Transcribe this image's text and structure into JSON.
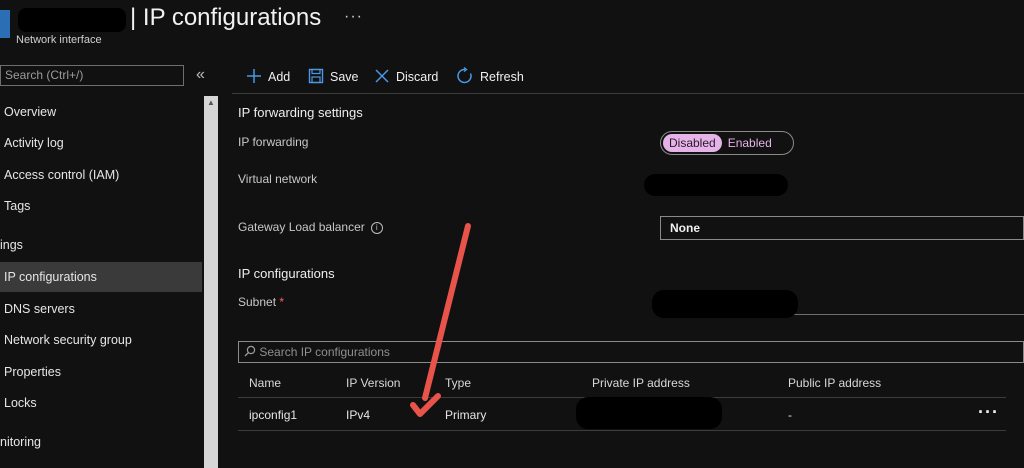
{
  "header": {
    "title": "| IP configurations",
    "more": "···",
    "subtitle": "Network interface"
  },
  "sidebar": {
    "search_placeholder": "Search (Ctrl+/)",
    "collapse": "«",
    "items": [
      {
        "label": "Overview"
      },
      {
        "label": "Activity log"
      },
      {
        "label": "Access control (IAM)"
      },
      {
        "label": "Tags"
      }
    ],
    "section_settings": "ings",
    "settings_items": [
      {
        "label": "IP configurations",
        "active": true
      },
      {
        "label": "DNS servers"
      },
      {
        "label": "Network security group"
      },
      {
        "label": "Properties"
      },
      {
        "label": "Locks"
      }
    ],
    "section_monitoring": "nitoring"
  },
  "toolbar": {
    "add_label": "Add",
    "save_label": "Save",
    "discard_label": "Discard",
    "refresh_label": "Refresh"
  },
  "form": {
    "forwarding_heading": "IP forwarding settings",
    "ip_forwarding_label": "IP forwarding",
    "toggle_disabled": "Disabled",
    "toggle_enabled": "Enabled",
    "toggle_selected": "Disabled",
    "virtual_network_label": "Virtual network",
    "gateway_lb_label": "Gateway Load balancer",
    "gateway_lb_value": "None",
    "ipconfig_heading": "IP configurations",
    "subnet_label": "Subnet",
    "subnet_required": "*"
  },
  "grid": {
    "search_placeholder": "Search IP configurations",
    "columns": [
      "Name",
      "IP Version",
      "Type",
      "Private IP address",
      "Public IP address"
    ],
    "rows": [
      {
        "name": "ipconfig1",
        "ip_version": "IPv4",
        "type": "Primary",
        "public_ip": "-",
        "more": "···"
      }
    ]
  },
  "colors": {
    "background": "#111111",
    "accent": "#4a98e6",
    "toggle_selected": "#e5b3e8",
    "annotation_arrow": "#e8534a"
  },
  "icons": [
    "network-interface-icon",
    "add-icon",
    "save-icon",
    "discard-icon",
    "refresh-icon",
    "search-icon",
    "info-icon",
    "more-icon"
  ]
}
